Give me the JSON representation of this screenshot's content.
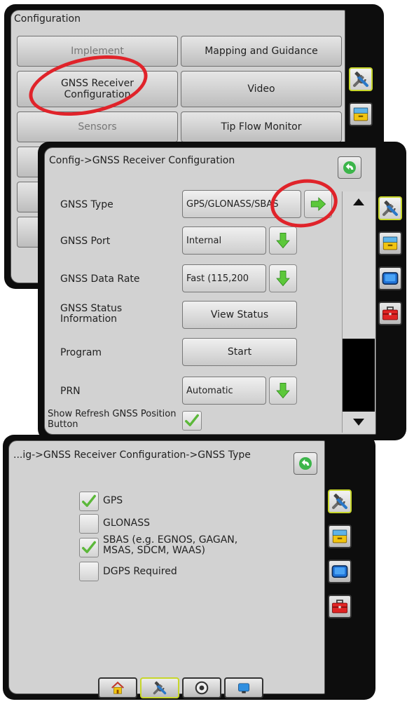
{
  "screen1": {
    "title": "Configuration",
    "buttons": [
      {
        "label": "Implement"
      },
      {
        "label": "Mapping and Guidance"
      },
      {
        "label": "GNSS Receiver Configuration"
      },
      {
        "label": "Video"
      },
      {
        "label": "Sensors"
      },
      {
        "label": "Tip Flow Monitor"
      }
    ]
  },
  "screen2": {
    "title": "Config->GNSS Receiver Configuration",
    "rows": [
      {
        "label": "GNSS Type",
        "value": "GPS/GLONASS/SBAS"
      },
      {
        "label": "GNSS Port",
        "value": "Internal"
      },
      {
        "label": "GNSS Data Rate",
        "value": "Fast (115,200"
      },
      {
        "label": "GNSS Status Information",
        "value": "View Status"
      },
      {
        "label": "Program",
        "value": "Start"
      },
      {
        "label": "PRN",
        "value": "Automatic"
      },
      {
        "label": "Show Refresh GNSS Position Button",
        "checked": true
      }
    ]
  },
  "screen3": {
    "title": "...ig->GNSS Receiver Configuration->GNSS Type",
    "options": [
      {
        "label": "GPS",
        "checked": true
      },
      {
        "label": "GLONASS",
        "checked": false
      },
      {
        "label": "SBAS (e.g. EGNOS, GAGAN, MSAS, SDCM, WAAS)",
        "checked": true
      },
      {
        "label": "DGPS Required",
        "checked": false
      }
    ]
  },
  "icons": {
    "config": "tools-icon",
    "data": "storage-drawer-icon",
    "display": "monitor-icon",
    "toolbox": "toolbox-icon",
    "home": "home-icon",
    "gauge": "gauge-icon",
    "globe": "globe-icon",
    "back": "back-arrow-icon"
  },
  "colors": {
    "highlight_ring": "#e0232a",
    "active_border": "#c7d62a",
    "green_arrow": "#5cc83a",
    "panel": "#d2d2d2"
  }
}
